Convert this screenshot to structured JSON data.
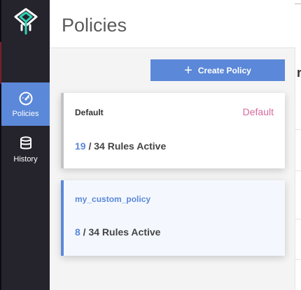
{
  "app": {
    "logo_icon": "brand-logo-icon"
  },
  "sidebar": {
    "items": [
      {
        "label": "Policies",
        "icon": "gauge-icon",
        "active": true
      },
      {
        "label": "History",
        "icon": "database-icon",
        "active": false
      }
    ]
  },
  "header": {
    "title": "Policies"
  },
  "toolbar": {
    "create_label": "Create Policy",
    "create_icon": "plus-icon"
  },
  "policies": [
    {
      "name": "Default",
      "tag": "Default",
      "active_rules": "19",
      "rules_suffix": " / 34 Rules Active"
    },
    {
      "name": "my_custom_policy",
      "tag": "",
      "active_rules": "8",
      "rules_suffix": " / 34 Rules Active"
    }
  ],
  "right_panel": {
    "partial_glyph": "r"
  },
  "colors": {
    "accent": "#5b88d8",
    "sidebar_bg": "#25232c",
    "default_tag": "#d66a9e"
  }
}
